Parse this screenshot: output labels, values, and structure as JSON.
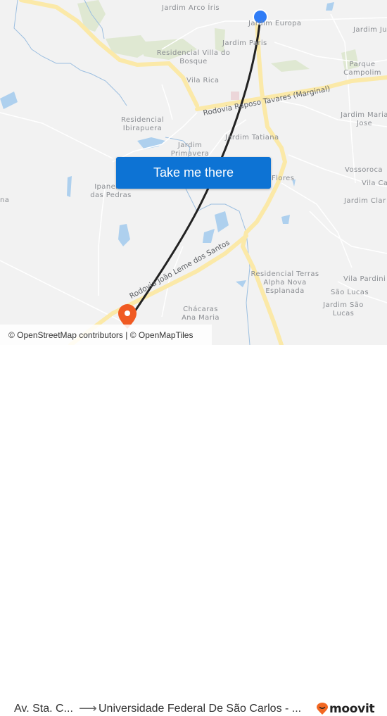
{
  "map": {
    "neighborhoods": [
      {
        "name": "Jardim Arco Íris"
      },
      {
        "name": "Jardim Europa"
      },
      {
        "name": "Jardim Ju"
      },
      {
        "name": "Jardim Paris"
      },
      {
        "name": "Residencial Villa do Bosque"
      },
      {
        "name": "Parque Campolim"
      },
      {
        "name": "Vila Rica"
      },
      {
        "name": "Residencial Ibirapuera"
      },
      {
        "name": "Jardim Maria Jose"
      },
      {
        "name": "Jardim Tatiana"
      },
      {
        "name": "Jardim Primavera"
      },
      {
        "name": "Vossoroca"
      },
      {
        "name": "Ipanema das Pedras"
      },
      {
        "name": "Flores"
      },
      {
        "name": "Vila Ca"
      },
      {
        "name": "na"
      },
      {
        "name": "Jardim Clar"
      },
      {
        "name": "Residencial Terras Alpha Nova Esplanada"
      },
      {
        "name": "Vila Pardini"
      },
      {
        "name": "São Lucas"
      },
      {
        "name": "Jardim São Lucas"
      },
      {
        "name": "Chácaras Ana Maria"
      }
    ],
    "roads": [
      {
        "name": "Rodovia Raposo Tavares (Marginal)"
      },
      {
        "name": "Rodovia João Leme dos Santos"
      }
    ],
    "origin_marker": {
      "type": "origin",
      "color": "#2f7cf6"
    },
    "destination_marker": {
      "type": "destination",
      "color": "#f05a22"
    },
    "route_color": "#222222"
  },
  "cta": {
    "label": "Take me there",
    "color": "#0d73d4"
  },
  "attribution": {
    "osm": "© OpenStreetMap contributors",
    "separator": " | ",
    "omt": "© OpenMapTiles"
  },
  "footer": {
    "origin": "Av. Sta. C...",
    "arrow": "⟶",
    "destination": "Universidade Federal De São Carlos - ...",
    "brand": "moovit",
    "brand_color": "#f26722"
  }
}
